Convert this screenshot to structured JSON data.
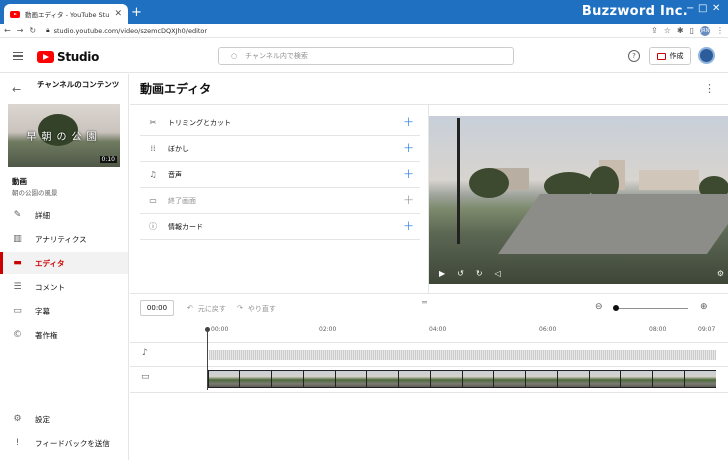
{
  "browser": {
    "tab_title": "動画エディタ - YouTube Studio",
    "brand": "Buzzword Inc.",
    "url": "studio.youtube.com/video/szemcDQXJh0/editor",
    "profile_initials": "JRN"
  },
  "header": {
    "logo_text": "Studio",
    "search_placeholder": "チャンネル内で検索",
    "help": "?",
    "create_label": "作成"
  },
  "sidebar": {
    "channel_title": "チャンネルのコンテンツ",
    "thumbnail_text": "早朝の公園",
    "duration": "0:10",
    "video_label": "動画",
    "video_name": "朝の公園の風景",
    "nav": [
      {
        "label": "詳細",
        "icon": "pencil-icon"
      },
      {
        "label": "アナリティクス",
        "icon": "analytics-icon"
      },
      {
        "label": "エディタ",
        "icon": "editor-icon",
        "active": true
      },
      {
        "label": "コメント",
        "icon": "comment-icon"
      },
      {
        "label": "字幕",
        "icon": "subtitles-icon"
      },
      {
        "label": "著作権",
        "icon": "copyright-icon"
      }
    ],
    "bottom": [
      {
        "label": "設定",
        "icon": "gear-icon"
      },
      {
        "label": "フィードバックを送信",
        "icon": "feedback-icon"
      }
    ]
  },
  "editor": {
    "title": "動画エディタ",
    "tools": [
      {
        "label": "トリミングとカット",
        "icon": "scissors-icon",
        "enabled": true
      },
      {
        "label": "ぼかし",
        "icon": "blur-icon",
        "enabled": true
      },
      {
        "label": "音声",
        "icon": "music-icon",
        "enabled": true
      },
      {
        "label": "終了画面",
        "icon": "end-screen-icon",
        "enabled": false
      },
      {
        "label": "情報カード",
        "icon": "info-icon",
        "enabled": true
      }
    ],
    "timecode": "00:00",
    "undo_label": "元に戻す",
    "redo_label": "やり直す",
    "ruler_ticks": [
      "00:00",
      "02:00",
      "04:00",
      "06:00",
      "08:00",
      "09:07"
    ]
  }
}
